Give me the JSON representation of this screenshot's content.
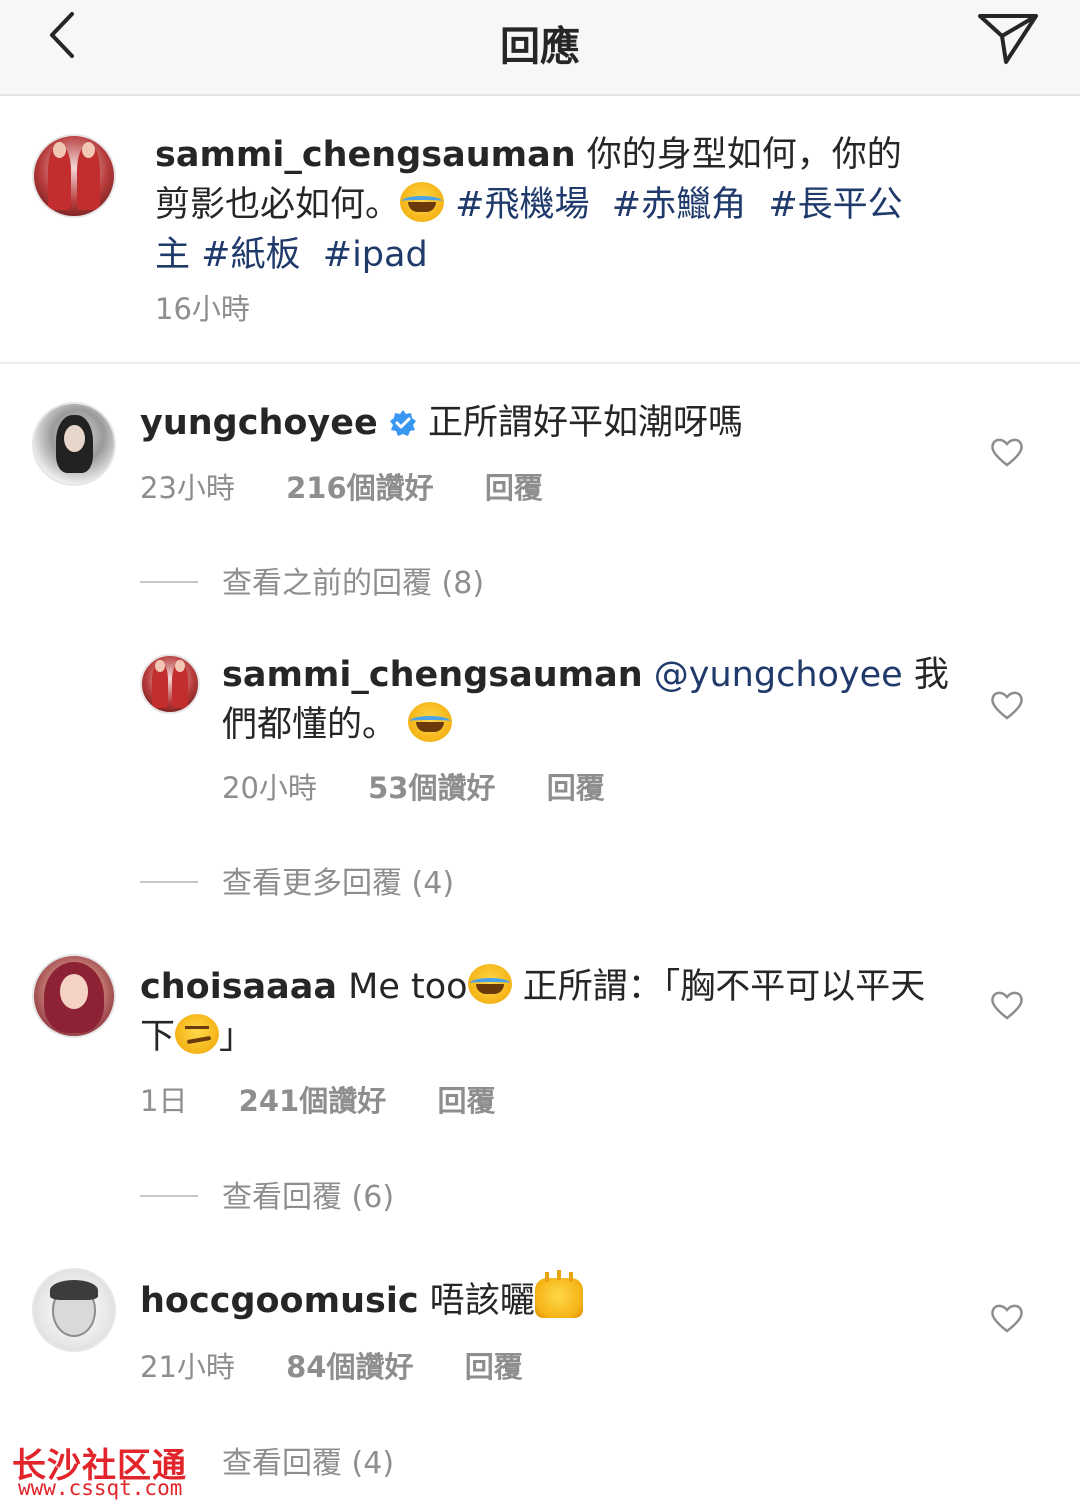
{
  "header": {
    "title": "回應",
    "back_icon": "chevron-left-icon",
    "send_icon": "paper-plane-icon"
  },
  "caption": {
    "username": "sammi_chengsauman",
    "text_1": " 你的身型如何，你的剪影也必如何。",
    "emoji": "face-with-tears-of-joy",
    "hashtags": [
      "#飛機場",
      "#赤鱲角",
      "#長平公主",
      "#紙板",
      "#ipad"
    ],
    "time": "16小時"
  },
  "comments": [
    {
      "username": "yungchoyee",
      "verified": true,
      "text": "正所謂好平如潮呀嗎",
      "time": "23小時",
      "likes": "216個讚好",
      "reply": "回覆",
      "view_replies": "查看之前的回覆 (8)",
      "replies": [
        {
          "username": "sammi_chengsauman",
          "mention": "@yungchoyee",
          "text": " 我們都懂的。",
          "time": "20小時",
          "likes": "53個讚好",
          "reply": "回覆"
        }
      ],
      "view_more": "查看更多回覆 (4)"
    },
    {
      "username": "choisaaaa",
      "text_1": " Me too",
      "text_2": " 正所謂：「胸不平可以平天下",
      "text_3": "」",
      "time": "1日",
      "likes": "241個讚好",
      "reply": "回覆",
      "view_replies": "查看回覆 (6)"
    },
    {
      "username": "hoccgoomusic",
      "text": " 唔該曬",
      "time": "21小時",
      "likes": "84個讚好",
      "reply": "回覆",
      "view_replies": "查看回覆 (4)"
    }
  ],
  "watermark": {
    "cn": "长沙社区通",
    "url": "www.cssqt.com"
  },
  "colors": {
    "hashtag": "#1f3a6b",
    "meta_gray": "#8e8e8e",
    "verified_blue": "#3897f0",
    "watermark_red": "#e1252a"
  }
}
